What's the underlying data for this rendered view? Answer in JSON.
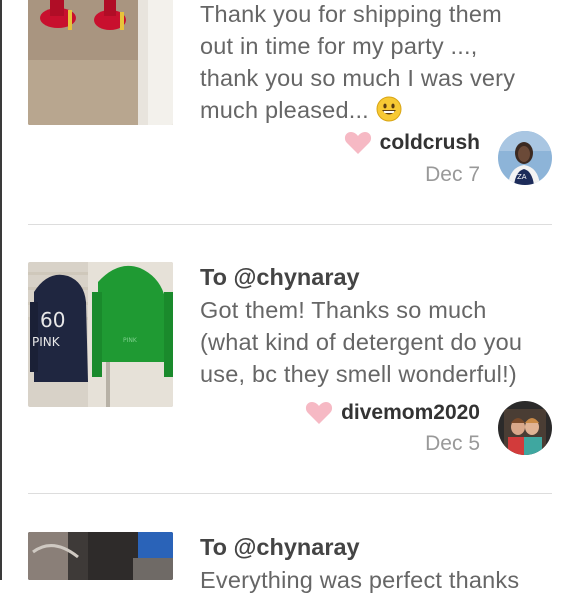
{
  "reviews": [
    {
      "body_lines": [
        "Thank you for shipping them",
        "out in time for my party ...,",
        "thank you so much I was very",
        "much pleased..."
      ],
      "username": "coldcrush",
      "date": "Dec 7"
    },
    {
      "to_label": "To @chynaray",
      "body_lines": [
        "Got them! Thanks so much",
        "(what kind of detergent do you",
        "use, bc they smell wonderful!)"
      ],
      "username": "divemom2020",
      "date": "Dec 5"
    },
    {
      "to_label": "To @chynaray",
      "body_lines": [
        "Everything was perfect thanks"
      ]
    }
  ],
  "colors": {
    "heart": "#f6b9c4",
    "divider": "#dddddd",
    "date": "#999999"
  },
  "icons": {
    "like": "heart-icon",
    "emoji": "grinning-face-emoji"
  }
}
